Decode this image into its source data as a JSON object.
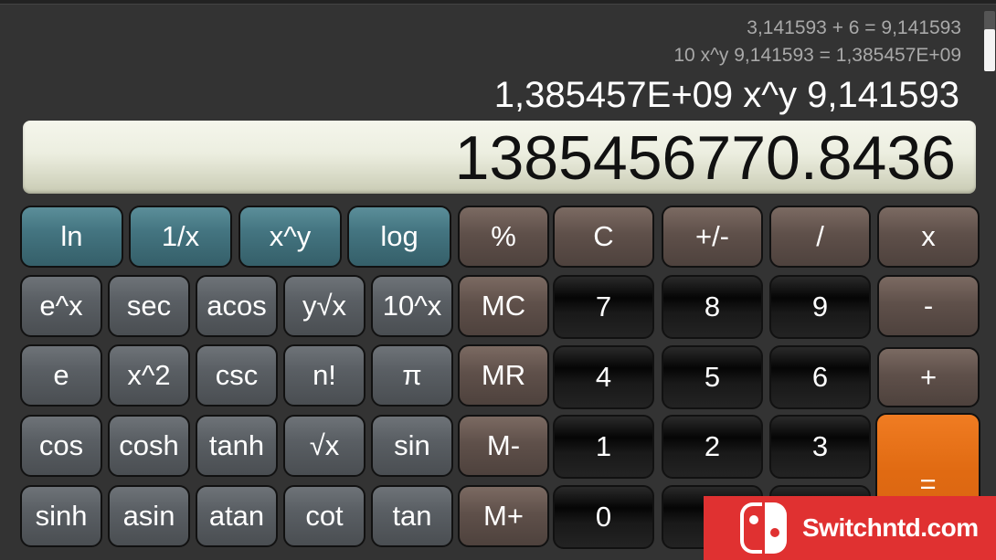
{
  "history": [
    "3,141593 + 6 = 9,141593",
    "10 x^y 9,141593 = 1,385457E+09"
  ],
  "current_expression": "1,385457E+09 x^y 9,141593",
  "display_value": "1385456770.8436",
  "keys": {
    "ln": "ln",
    "inv": "1/x",
    "xpowy": "x^y",
    "log": "log",
    "percent": "%",
    "clear": "C",
    "sign": "+/-",
    "divide": "/",
    "multiply": "x",
    "exp": "e^x",
    "sec": "sec",
    "acos": "acos",
    "yroot": "y√x",
    "tenpow": "10^x",
    "mc": "MC",
    "d7": "7",
    "d8": "8",
    "d9": "9",
    "minus": "-",
    "e": "e",
    "sq": "x^2",
    "csc": "csc",
    "fact": "n!",
    "pi": "π",
    "mr": "MR",
    "d4": "4",
    "d5": "5",
    "d6": "6",
    "plus": "+",
    "cos": "cos",
    "cosh": "cosh",
    "tanh": "tanh",
    "sqrt": "√x",
    "sin": "sin",
    "mminus": "M-",
    "d1": "1",
    "d2": "2",
    "d3": "3",
    "equals": "=",
    "sinh": "sinh",
    "asin": "asin",
    "atan": "atan",
    "cot": "cot",
    "tan": "tan",
    "mplus": "M+",
    "d0": "0"
  },
  "watermark": {
    "text": "Switchntd.com",
    "icon": "nintendo-switch-logo"
  },
  "colors": {
    "scientific_teal": "#447581",
    "function_gray": "#5a5f64",
    "operator_brown": "#5f504a",
    "digit_black": "#0a0a0a",
    "equals_orange": "#e06a12",
    "watermark_red": "#e03131"
  }
}
